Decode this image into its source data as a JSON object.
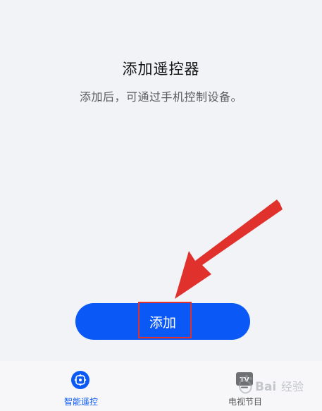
{
  "page": {
    "title": "添加遥控器",
    "subtitle": "添加后，可通过手机控制设备。"
  },
  "primary_action": {
    "add_label": "添加"
  },
  "tabbar": {
    "tabs": [
      {
        "label": "智能遥控",
        "icon": "remote-control-icon",
        "active": true
      },
      {
        "label": "电视节目",
        "icon": "tv-icon",
        "active": false
      }
    ],
    "tv_icon_text": "TV"
  },
  "watermark": {
    "text": "Bai 经验"
  },
  "colors": {
    "accent": "#0a59f7",
    "background": "#f2f3f7",
    "annotation": "#e0312c"
  }
}
